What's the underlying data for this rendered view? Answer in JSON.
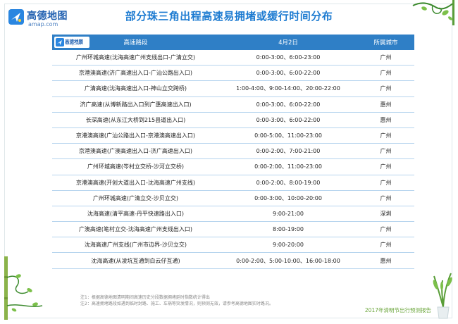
{
  "brand": {
    "name_cn": "高德地图",
    "domain": "amap.com"
  },
  "title": "部分珠三角出程高速易拥堵或缓行时间分布",
  "table": {
    "headers": [
      "高速路段",
      "4月2日",
      "所属城市"
    ],
    "rows": [
      [
        "广州环城高速(沈海高速广州支线出口-广清立交)",
        "0:00-3:00、6:00-23:00",
        "广州"
      ],
      [
        "京港澳高速(济广高速出入口-广汕公路出入口)",
        "0:00-3:00、6:00-22:00",
        "广州"
      ],
      [
        "广清高速(沈海高速出入口-神山立交跨桥)",
        "1:00-4:00、9:00-14:00、20:00-22:00",
        "广州"
      ],
      [
        "济广高速(从博新路出入口到广惠高速出入口)",
        "0:00-3:00、6:00-22:00",
        "惠州"
      ],
      [
        "长深高速(从东江大桥到215县道出入口)",
        "0:00-3:00、6:00-22:00",
        "惠州"
      ],
      [
        "京港澳高速(广汕公路出入口-京港澳高速出入口)",
        "0:00-5:00、11:00-23:00",
        "广州"
      ],
      [
        "京港澳高速(广澳高速出入口-济广高速出入口)",
        "0:00-2:00、7:00-21:00",
        "广州"
      ],
      [
        "广州环城高速(岑村立交桥-沙河立交桥)",
        "0:00-2:00、11:00-23:00",
        "广州"
      ],
      [
        "京港澳高速(开创大道出入口-沈海高速广州支线)",
        "0:00-2:00、8:00-19:00",
        "广州"
      ],
      [
        "广州环城高速(广清立交-沙贝立交)",
        "0:00-3:00、10:00-20:00",
        "广州"
      ],
      [
        "沈海高速(清平高速-丹平快速路出入口)",
        "9:00-21:00",
        "深圳"
      ],
      [
        "广澳高速(笔村立交-沈海高速广州支线出入口)",
        "8:00-19:00",
        "广州"
      ],
      [
        "沈海高速广州支线(广州市边界-沙贝立交)",
        "9:00-20:00",
        "广州"
      ],
      [
        "沈海高速(从凌坑互通到白云仔互通)",
        "0:00-2:00、5:00-10:00、16:00-18:00",
        "惠州"
      ]
    ]
  },
  "notes": [
    "注1：根据高德地图清明期间高速历史分段数据拥堵延时指数统计得出",
    "注2：高速拥堵路段如遇到临时封路、施工、车祸等突发情况，则预测无效，请参考高德地图实时路况。"
  ],
  "report_label": "2017年清明节出行预测报告",
  "colors": {
    "title": "#1d7bd1",
    "header_bg": "#2f7fc6",
    "row_line": "#b6d4ee",
    "vine": "#3c8a2e",
    "report": "#6aa53a"
  },
  "icons": [
    "amap-logo-icon",
    "vine-decoration-icon",
    "plant-decoration-icon"
  ]
}
